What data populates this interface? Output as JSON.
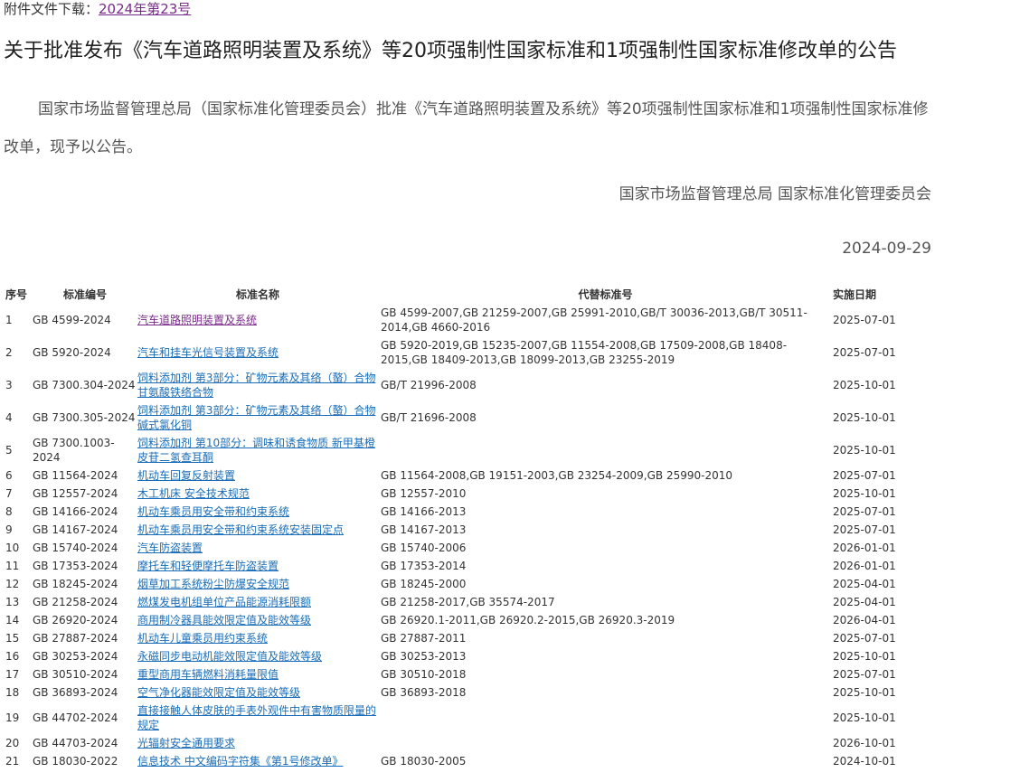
{
  "attachment": {
    "label": "附件文件下载：",
    "link_text": "2024年第23号"
  },
  "title": "关于批准发布《汽车道路照明装置及系统》等20项强制性国家标准和1项强制性国家标准修改单的公告",
  "body": "国家市场监督管理总局（国家标准化管理委员会）批准《汽车道路照明装置及系统》等20项强制性国家标准和1项强制性国家标准修改单，现予以公告。",
  "signature": "国家市场监督管理总局 国家标准化管理委员会",
  "date": "2024-09-29",
  "table": {
    "headers": {
      "no": "序号",
      "code": "标准编号",
      "name": "标准名称",
      "replaces": "代替标准号",
      "effective": "实施日期"
    },
    "rows": [
      {
        "no": "1",
        "code": "GB 4599-2024",
        "name": "汽车道路照明装置及系统",
        "replaces": "GB 4599-2007,GB 21259-2007,GB 25991-2010,GB/T 30036-2013,GB/T 30511-2014,GB 4660-2016",
        "effective": "2025-07-01"
      },
      {
        "no": "2",
        "code": "GB 5920-2024",
        "name": "汽车和挂车光信号装置及系统",
        "replaces": "GB 5920-2019,GB 15235-2007,GB 11554-2008,GB 17509-2008,GB 18408-2015,GB 18409-2013,GB 18099-2013,GB 23255-2019",
        "effective": "2025-07-01"
      },
      {
        "no": "3",
        "code": "GB 7300.304-2024",
        "name": "饲料添加剂 第3部分：矿物元素及其络（螯）合物 甘氨酸铁络合物",
        "replaces": "GB/T 21996-2008",
        "effective": "2025-10-01"
      },
      {
        "no": "4",
        "code": "GB 7300.305-2024",
        "name": "饲料添加剂 第3部分：矿物元素及其络（螯）合物 碱式氯化铜",
        "replaces": "GB/T 21696-2008",
        "effective": "2025-10-01"
      },
      {
        "no": "5",
        "code": "GB 7300.1003-2024",
        "name": "饲料添加剂 第10部分：调味和诱食物质 新甲基橙皮苷二氢查耳酮",
        "replaces": "",
        "effective": "2025-10-01"
      },
      {
        "no": "6",
        "code": "GB 11564-2024",
        "name": "机动车回复反射装置",
        "replaces": "GB 11564-2008,GB 19151-2003,GB 23254-2009,GB 25990-2010",
        "effective": "2025-07-01"
      },
      {
        "no": "7",
        "code": "GB 12557-2024",
        "name": "木工机床 安全技术规范",
        "replaces": "GB 12557-2010",
        "effective": "2025-10-01"
      },
      {
        "no": "8",
        "code": "GB 14166-2024",
        "name": "机动车乘员用安全带和约束系统",
        "replaces": "GB 14166-2013",
        "effective": "2025-07-01"
      },
      {
        "no": "9",
        "code": "GB 14167-2024",
        "name": "机动车乘员用安全带和约束系统安装固定点",
        "replaces": "GB 14167-2013",
        "effective": "2025-07-01"
      },
      {
        "no": "10",
        "code": "GB 15740-2024",
        "name": "汽车防盗装置",
        "replaces": "GB 15740-2006",
        "effective": "2026-01-01"
      },
      {
        "no": "11",
        "code": "GB 17353-2024",
        "name": "摩托车和轻便摩托车防盗装置",
        "replaces": "GB 17353-2014",
        "effective": "2026-01-01"
      },
      {
        "no": "12",
        "code": "GB 18245-2024",
        "name": "烟草加工系统粉尘防爆安全规范",
        "replaces": "GB 18245-2000",
        "effective": "2025-04-01"
      },
      {
        "no": "13",
        "code": "GB 21258-2024",
        "name": "燃煤发电机组单位产品能源消耗限额",
        "replaces": "GB 21258-2017,GB 35574-2017",
        "effective": "2025-04-01"
      },
      {
        "no": "14",
        "code": "GB 26920-2024",
        "name": "商用制冷器具能效限定值及能效等级",
        "replaces": "GB 26920.1-2011,GB 26920.2-2015,GB 26920.3-2019",
        "effective": "2026-04-01"
      },
      {
        "no": "15",
        "code": "GB 27887-2024",
        "name": "机动车儿童乘员用约束系统",
        "replaces": "GB 27887-2011",
        "effective": "2025-07-01"
      },
      {
        "no": "16",
        "code": "GB 30253-2024",
        "name": "永磁同步电动机能效限定值及能效等级",
        "replaces": "GB 30253-2013",
        "effective": "2025-10-01"
      },
      {
        "no": "17",
        "code": "GB 30510-2024",
        "name": "重型商用车辆燃料消耗量限值",
        "replaces": "GB 30510-2018",
        "effective": "2025-07-01"
      },
      {
        "no": "18",
        "code": "GB 36893-2024",
        "name": "空气净化器能效限定值及能效等级",
        "replaces": "GB 36893-2018",
        "effective": "2025-10-01"
      },
      {
        "no": "19",
        "code": "GB 44702-2024",
        "name": "直接接触人体皮肤的手表外观件中有害物质限量的规定",
        "replaces": "",
        "effective": "2025-10-01"
      },
      {
        "no": "20",
        "code": "GB 44703-2024",
        "name": "光辐射安全通用要求",
        "replaces": "",
        "effective": "2026-10-01"
      },
      {
        "no": "21",
        "code": "GB 18030-2022",
        "name": "信息技术 中文编码字符集《第1号修改单》",
        "replaces": "GB 18030-2005",
        "effective": "2024-10-01"
      }
    ]
  }
}
